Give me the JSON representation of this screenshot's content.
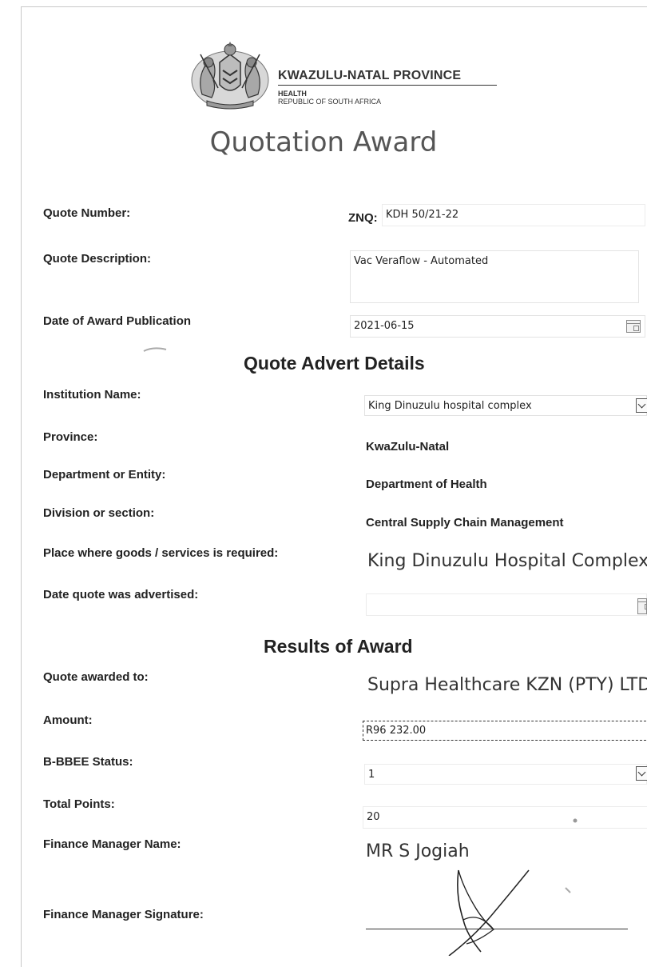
{
  "header": {
    "province_name": "KWAZULU-NATAL PROVINCE",
    "department": "HEALTH",
    "country": "REPUBLIC OF SOUTH AFRICA",
    "crest_icon": "coat-of-arms-icon"
  },
  "title": "Quotation Award",
  "quote": {
    "number_label": "Quote Number:",
    "number_prefix": "ZNQ:",
    "number_value": "KDH 50/21-22",
    "description_label": "Quote Description:",
    "description_value": "Vac Veraflow - Automated",
    "publication_label": "Date of Award Publication",
    "publication_value": "2021-06-15"
  },
  "advert": {
    "heading": "Quote Advert Details",
    "institution_label": "Institution Name:",
    "institution_value": "King Dinuzulu hospital complex",
    "province_label": "Province:",
    "province_value": "KwaZulu-Natal",
    "department_label": "Department or Entity:",
    "department_value": "Department of Health",
    "division_label": "Division or section:",
    "division_value": "Central Supply Chain Management",
    "place_label": "Place where goods /  services is required:",
    "place_value": "King Dinuzulu Hospital Complex",
    "advertised_label": "Date quote was advertised:",
    "advertised_value": ""
  },
  "results": {
    "heading": "Results of Award",
    "awarded_label": "Quote awarded to:",
    "awarded_value": "Supra Healthcare KZN (PTY) LTD",
    "amount_label": "Amount:",
    "amount_value": "R96 232.00",
    "bbbee_label": "B-BBEE Status:",
    "bbbee_value": "1",
    "points_label": "Total Points:",
    "points_value": "20",
    "finance_name_label": "Finance Manager Name:",
    "finance_name_value": "MR S Jogiah",
    "finance_signature_label": "Finance Manager Signature:"
  }
}
